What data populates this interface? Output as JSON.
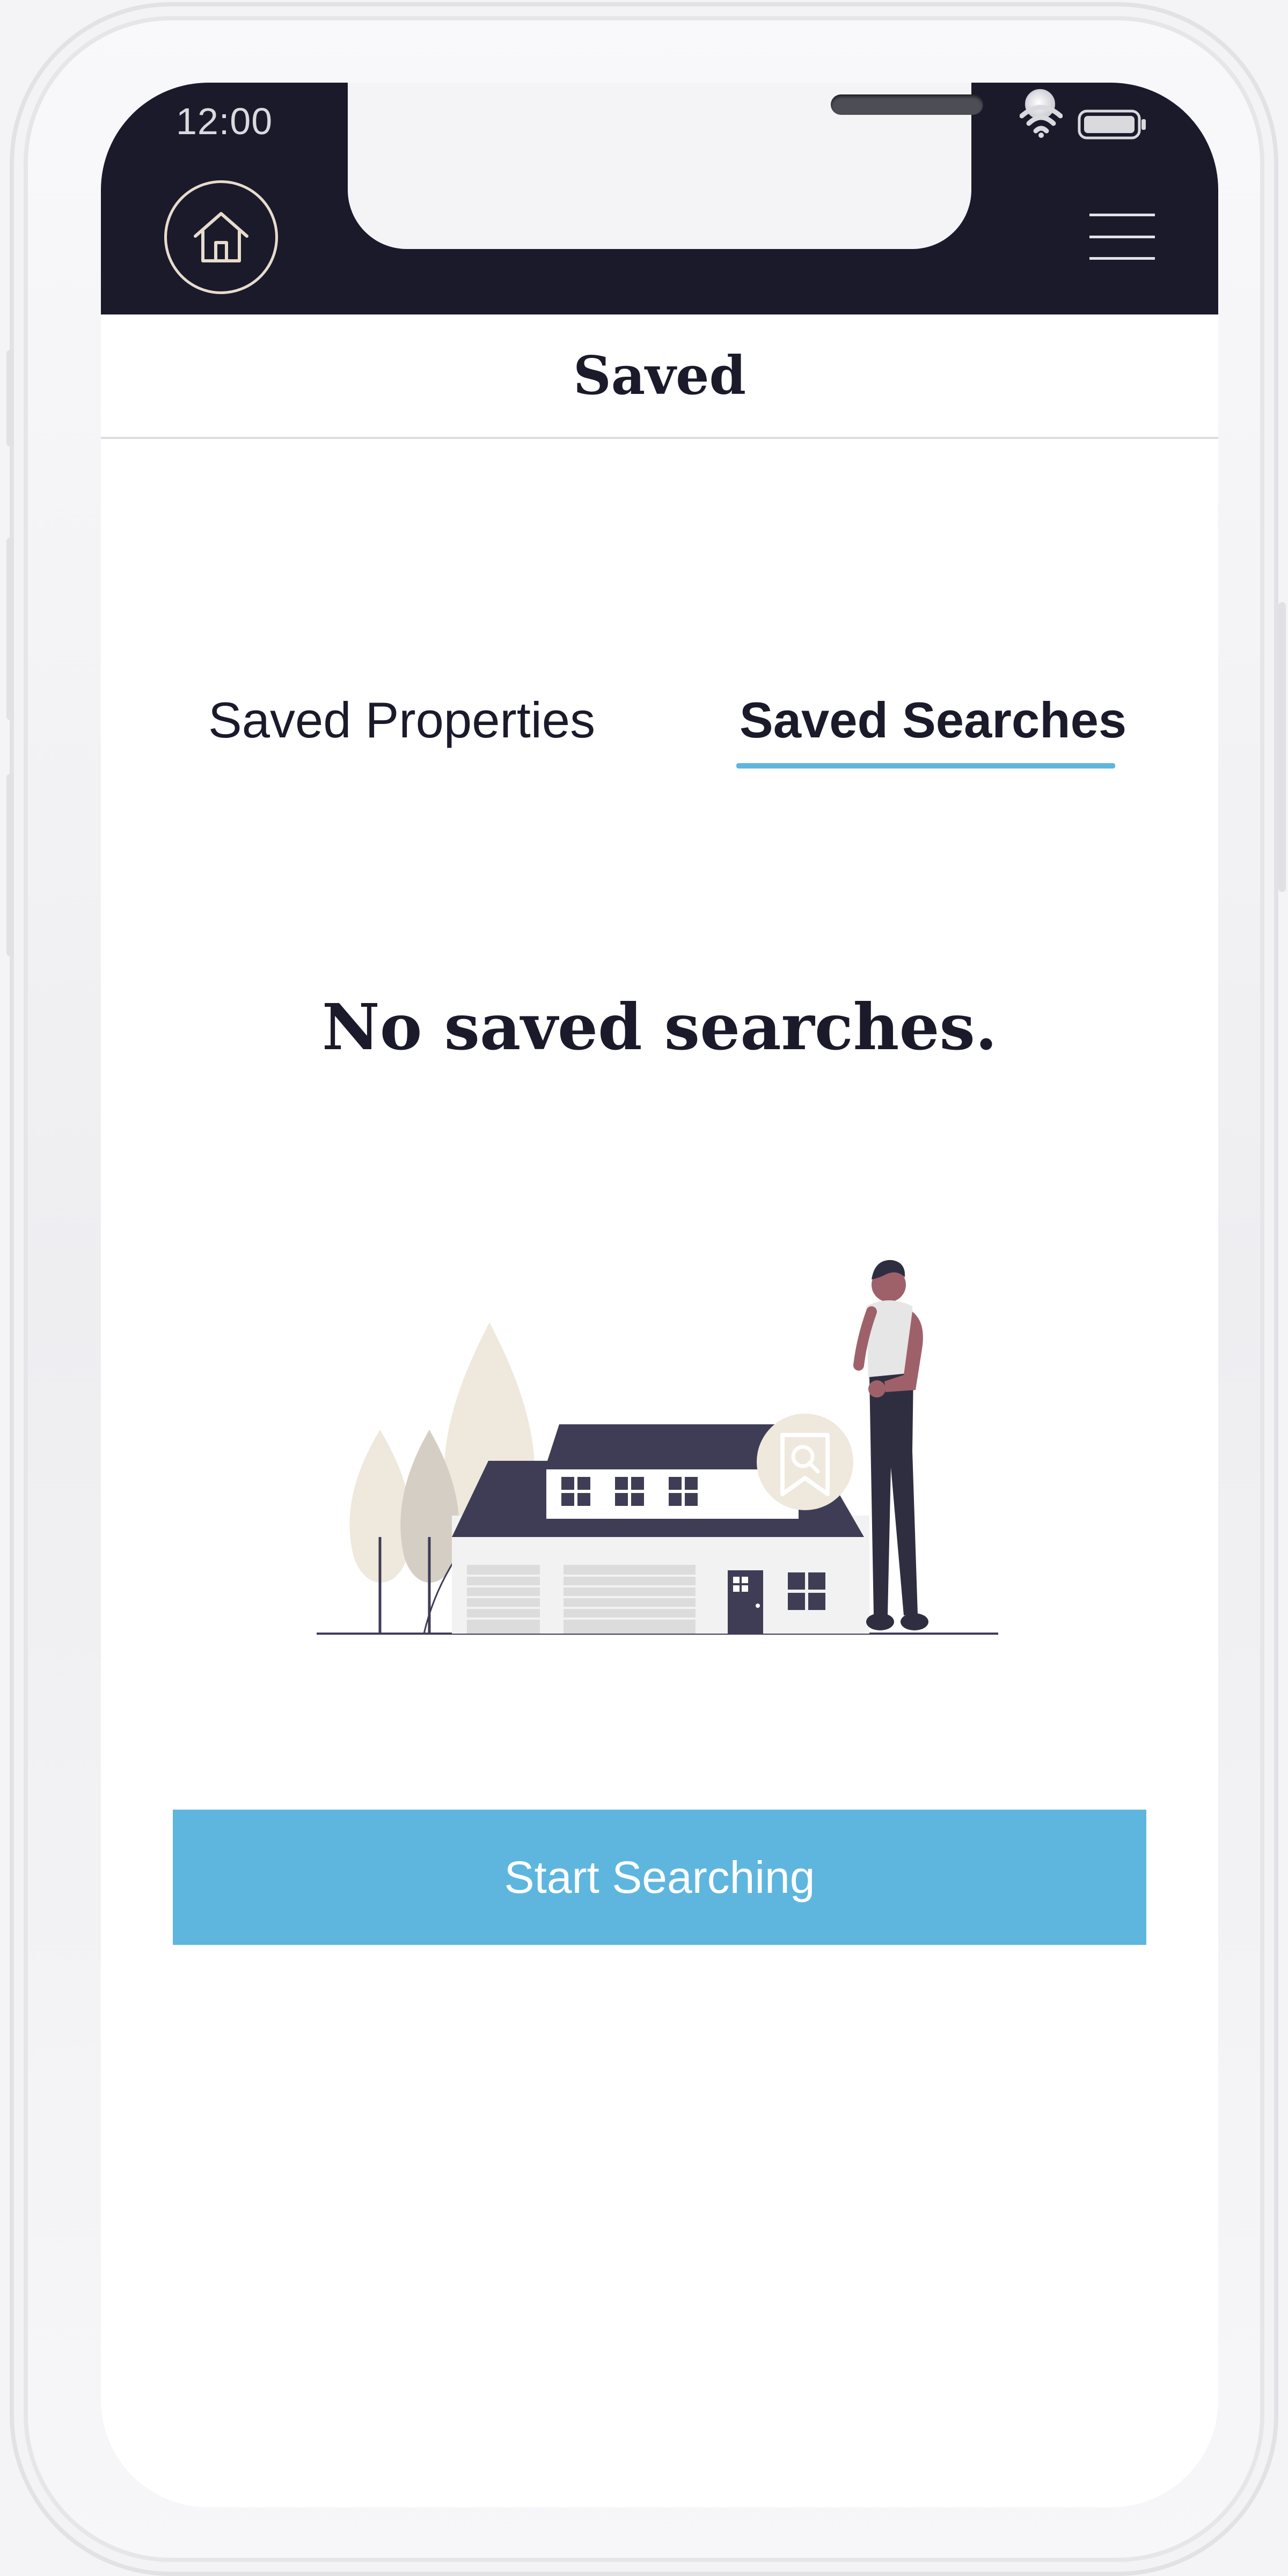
{
  "status_bar": {
    "time": "12:00",
    "wifi_icon": "wifi-icon",
    "battery_icon": "battery-icon"
  },
  "header": {
    "home_icon": "house-icon",
    "menu_icon": "hamburger-menu-icon",
    "title": "Saved"
  },
  "tabs": [
    {
      "label": "Saved Properties",
      "active": false
    },
    {
      "label": "Saved Searches",
      "active": true
    }
  ],
  "empty_state": {
    "message": "No saved searches.",
    "illustration": "house-with-person-illustration"
  },
  "cta": {
    "label": "Start Searching"
  },
  "colors": {
    "header_bg": "#1b1a2b",
    "accent": "#5eb6df",
    "text": "#1b1a2b",
    "beige": "#e7dccd"
  }
}
